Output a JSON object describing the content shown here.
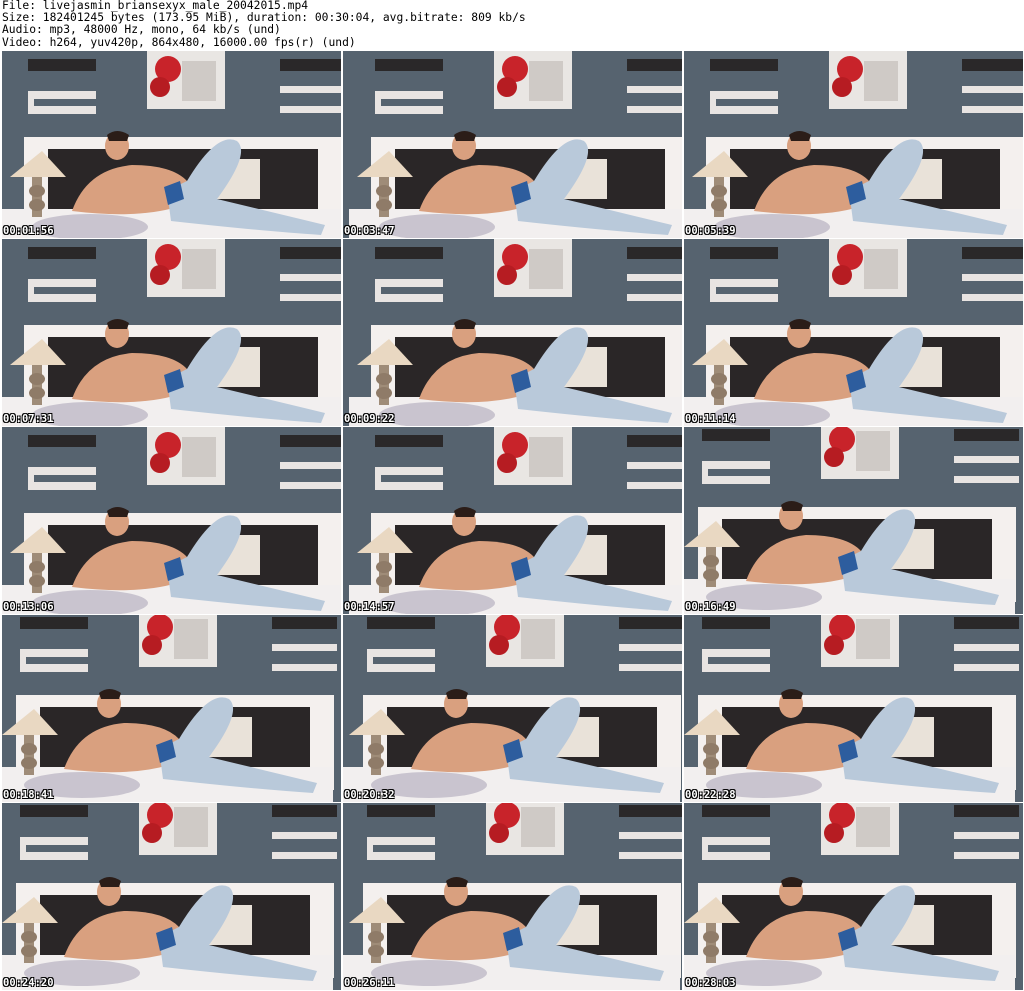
{
  "header": {
    "file": "File: livejasmin_briansexyx_male_20042015.mp4",
    "size": "Size: 182401245 bytes (173.95 MiB), duration: 00:30:04, avg.bitrate: 809 kb/s",
    "audio": "Audio: mp3, 48000 Hz, mono, 64 kb/s (und)",
    "video": "Video: h264, yuv420p, 864x480, 16000.00 fps(r) (und)"
  },
  "thumbnails": [
    {
      "timestamp": "00:01:56"
    },
    {
      "timestamp": "00:03:47"
    },
    {
      "timestamp": "00:05:39"
    },
    {
      "timestamp": "00:07:31"
    },
    {
      "timestamp": "00:09:22"
    },
    {
      "timestamp": "00:11:14"
    },
    {
      "timestamp": "00:13:06"
    },
    {
      "timestamp": "00:14:57"
    },
    {
      "timestamp": "00:16:49"
    },
    {
      "timestamp": "00:18:41"
    },
    {
      "timestamp": "00:20:32"
    },
    {
      "timestamp": "00:22:28"
    },
    {
      "timestamp": "00:24:20"
    },
    {
      "timestamp": "00:26:11"
    },
    {
      "timestamp": "00:28:03"
    }
  ],
  "colors": {
    "wall": "#56636f",
    "headboard": "#f4f0ee",
    "headboard_dark": "#2a2627",
    "sheet": "#f2efef",
    "skin": "#d9a07f",
    "jeans": "#b9c9da",
    "lamp_shade": "#e9d8c2",
    "poster_red": "#c8232a"
  }
}
